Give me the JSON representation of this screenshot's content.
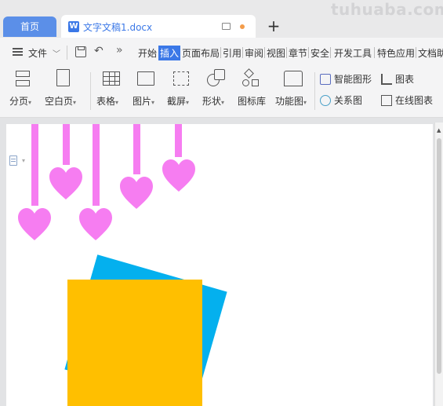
{
  "tabs": {
    "home_label": "首页",
    "doc_title": "文字文稿1.docx",
    "doc_icon": "W"
  },
  "watermark": "tuhuaba.com",
  "toolbar": {
    "file_label": "文件"
  },
  "menu": [
    {
      "label": "开始"
    },
    {
      "label": "插入",
      "active": true
    },
    {
      "label": "页面布局"
    },
    {
      "label": "引用"
    },
    {
      "label": "审阅"
    },
    {
      "label": "视图"
    },
    {
      "label": "章节"
    },
    {
      "label": "安全"
    },
    {
      "label": "开发工具"
    },
    {
      "label": "特色应用"
    },
    {
      "label": "文档助"
    }
  ],
  "ribbon": {
    "page_break": "分页",
    "blank_page": "空白页",
    "table": "表格",
    "picture": "图片",
    "screenshot": "截屏",
    "shape": "形状",
    "icon_library": "图标库",
    "function_chart": "功能图",
    "smart_art": "智能图形",
    "relation_chart": "关系图",
    "chart": "图表",
    "online_chart": "在线图表"
  },
  "colors": {
    "heart": "#f67df1",
    "blue_shape": "#04b0ee",
    "orange_shape": "#ffbf00",
    "accent": "#3b78e7"
  }
}
